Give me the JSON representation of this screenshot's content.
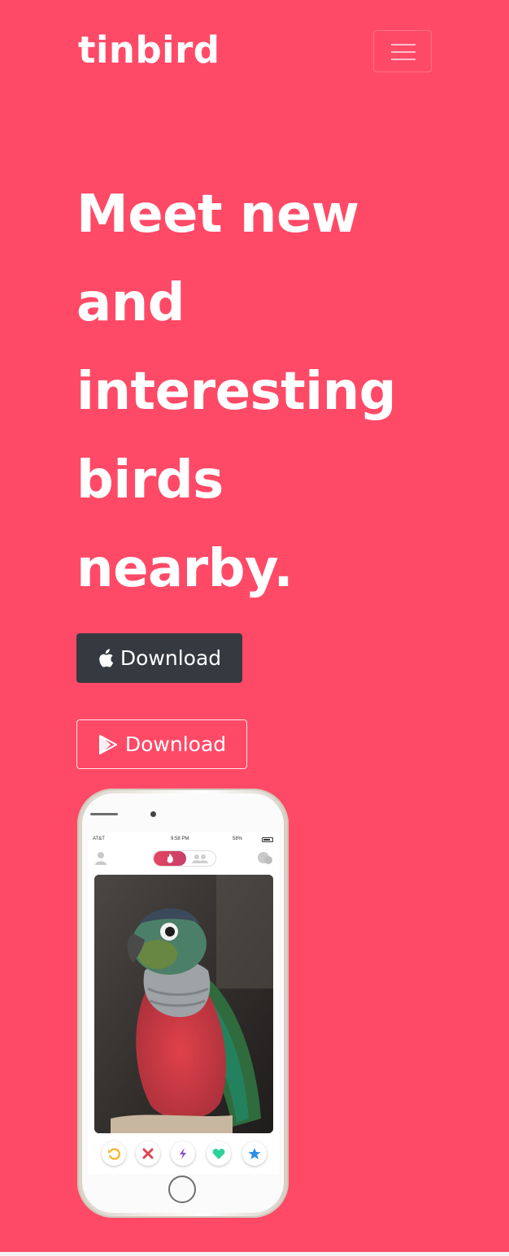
{
  "navbar": {
    "brand": "tinbird",
    "menu_icon": "hamburger-menu-icon"
  },
  "hero": {
    "headline_lines": [
      "Meet new",
      "and",
      "interesting",
      "birds",
      "nearby."
    ],
    "ios_button": {
      "label": "Download",
      "icon": "apple-icon"
    },
    "android_button": {
      "label": "Download",
      "icon": "google-play-icon"
    }
  },
  "phone_screen": {
    "status": {
      "carrier": "AT&T",
      "time": "9:58 PM",
      "battery": "58%"
    },
    "header_icons": [
      "profile-icon",
      "flame-icon",
      "groups-icon",
      "chat-icon"
    ],
    "photo": "parrot-photo",
    "actions": [
      {
        "icon": "rewind-icon",
        "color": "#f5b730"
      },
      {
        "icon": "close-icon",
        "color": "#e0424f"
      },
      {
        "icon": "boost-icon",
        "color": "#8a4ad8"
      },
      {
        "icon": "heart-icon",
        "color": "#2fd39a"
      },
      {
        "icon": "star-icon",
        "color": "#2d8ee5"
      }
    ]
  },
  "colors": {
    "background": "#ff4a67",
    "dark_button": "#343a40"
  }
}
